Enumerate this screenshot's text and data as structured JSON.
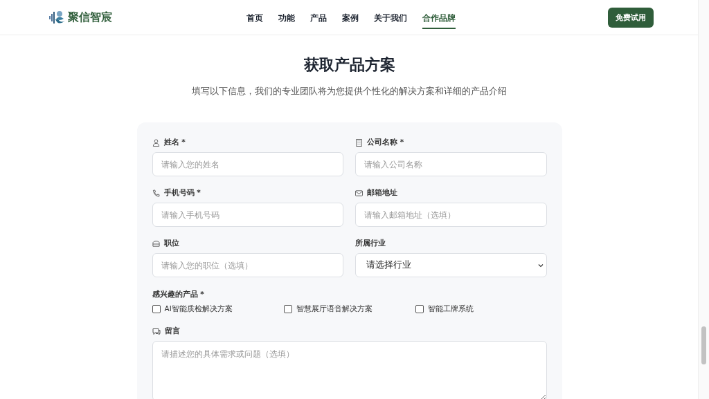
{
  "header": {
    "brand": "聚信智宸",
    "nav": [
      {
        "label": "首页",
        "selected": false
      },
      {
        "label": "功能",
        "selected": false
      },
      {
        "label": "产品",
        "selected": false
      },
      {
        "label": "案例",
        "selected": false
      },
      {
        "label": "关于我们",
        "selected": false
      },
      {
        "label": "合作品牌",
        "selected": true
      }
    ],
    "cta": "免费试用"
  },
  "title": "获取产品方案",
  "subtitle": "填写以下信息，我们的专业团队将为您提供个性化的解决方案和详细的产品介绍",
  "form": {
    "fields": [
      {
        "kind": "input",
        "label": "姓名 *",
        "placeholder": "请输入您的姓名"
      },
      {
        "kind": "input",
        "label": "公司名称 *",
        "placeholder": "请输入公司名称"
      },
      {
        "kind": "input",
        "label": "手机号码 *",
        "placeholder": "请输入手机号码"
      },
      {
        "kind": "input",
        "label": "邮箱地址",
        "placeholder": "请输入邮箱地址（选填）"
      },
      {
        "kind": "input",
        "label": "职位",
        "placeholder": "请输入您的职位（选填）"
      },
      {
        "kind": "select",
        "label": "所属行业",
        "value": "请选择行业"
      }
    ],
    "products_label": "感兴趣的产品 *",
    "products": [
      {
        "label": "AI智能质检解决方案",
        "checked": false
      },
      {
        "label": "智慧展厅语音解决方案",
        "checked": false
      },
      {
        "label": "智能工牌系统",
        "checked": false
      }
    ],
    "message": {
      "label": "留言",
      "placeholder": "请描述您的具体需求或问题（选填）"
    }
  }
}
